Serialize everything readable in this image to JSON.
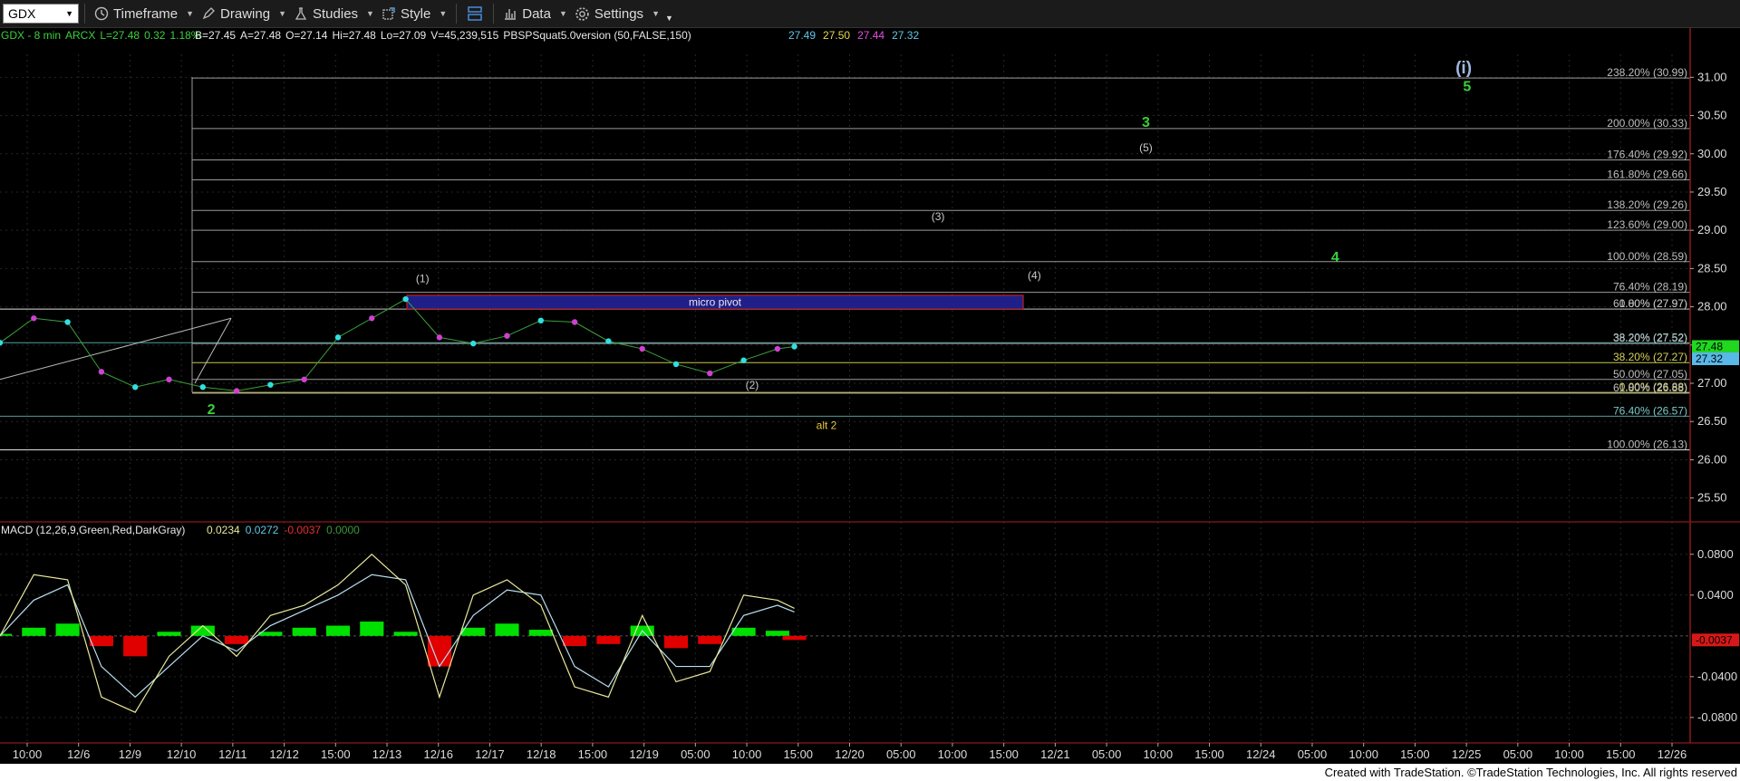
{
  "toolbar": {
    "symbol": "GDX",
    "timeframe_label": "Timeframe",
    "drawing_label": "Drawing",
    "studies_label": "Studies",
    "style_label": "Style",
    "data_label": "Data",
    "settings_label": "Settings"
  },
  "info_bar": {
    "symbol": "GDX - 8 min",
    "exchange": "ARCX",
    "last": "L=27.48",
    "change": "0.32",
    "change_pct": "1.18%",
    "bid": "B=27.45",
    "ask": "A=27.48",
    "open": "O=27.14",
    "high": "Hi=27.48",
    "low": "Lo=27.09",
    "volume": "V=45,239,515",
    "study": "PBSPSquat5.0version (50,FALSE,150)",
    "study_values": [
      "27.49",
      "27.50",
      "27.44",
      "27.32"
    ]
  },
  "colors": {
    "background": "#000000",
    "grid": "#262626",
    "macd_hist_pos": "#00e000",
    "macd_hist_neg": "#e00000",
    "macd_line": "#e8e89a",
    "signal_line": "#b8e0f0",
    "wave_green": "#3ad13a",
    "pivot_box": "#1f1f8a",
    "price_candle": "#30e0e0",
    "price_dot": "#d040d0"
  },
  "chart_data": [
    {
      "type": "line",
      "panel": "price",
      "y_axis": {
        "range": [
          25.2,
          31.3
        ],
        "ticks": [
          "31.00",
          "30.50",
          "30.00",
          "29.50",
          "29.00",
          "28.50",
          "28.00",
          "27.50",
          "27.00",
          "26.50",
          "26.00",
          "25.50"
        ]
      },
      "x_axis": {
        "ticks": [
          "10:00",
          "12/6",
          "12/9",
          "12/10",
          "12/11",
          "12/12",
          "15:00",
          "12/13",
          "12/16",
          "12/17",
          "12/18",
          "15:00",
          "12/19",
          "05:00",
          "10:00",
          "15:00",
          "12/20",
          "05:00",
          "10:00",
          "15:00",
          "12/21",
          "05:00",
          "10:00",
          "15:00",
          "12/24",
          "05:00",
          "10:00",
          "15:00",
          "12/25",
          "05:00",
          "10:00",
          "15:00",
          "12/26"
        ]
      },
      "series": [
        {
          "x": [
            0,
            0.02,
            0.04,
            0.06,
            0.08,
            0.1,
            0.12,
            0.14,
            0.16,
            0.18,
            0.2,
            0.22,
            0.24,
            0.26,
            0.28,
            0.3,
            0.32,
            0.34,
            0.36,
            0.38,
            0.4,
            0.42,
            0.44,
            0.46,
            0.47
          ],
          "values": [
            27.53,
            27.85,
            27.8,
            27.15,
            26.95,
            27.05,
            26.95,
            26.9,
            26.98,
            27.05,
            27.6,
            27.85,
            28.1,
            27.6,
            27.52,
            27.62,
            27.82,
            27.8,
            27.55,
            27.45,
            27.25,
            27.13,
            27.3,
            27.45,
            27.48
          ]
        }
      ],
      "fib_levels": [
        {
          "label": "238.20% (30.99)",
          "value": 30.99,
          "color": "#9a9a9a"
        },
        {
          "label": "200.00% (30.33)",
          "value": 30.33,
          "color": "#9a9a9a"
        },
        {
          "label": "176.40% (29.92)",
          "value": 29.92,
          "color": "#9a9a9a"
        },
        {
          "label": "161.80% (29.66)",
          "value": 29.66,
          "color": "#9a9a9a"
        },
        {
          "label": "138.20% (29.26)",
          "value": 29.26,
          "color": "#9a9a9a"
        },
        {
          "label": "123.60% (29.00)",
          "value": 29.0,
          "color": "#9a9a9a"
        },
        {
          "label": "100.00% (28.59)",
          "value": 28.59,
          "color": "#9a9a9a"
        },
        {
          "label": "76.40% (28.19)",
          "value": 28.19,
          "color": "#9a9a9a"
        },
        {
          "label": "0.00% (27.97)",
          "value": 27.97,
          "color": "#e0e0e0"
        },
        {
          "label": "61.80% (27.97)",
          "value": 27.97,
          "color": "#9a9a9a"
        },
        {
          "label": "38.20% (27.52)",
          "value": 27.53,
          "color": "#4fa0a0"
        },
        {
          "label": "38.20% (27.52)",
          "value": 27.52,
          "color": "#9a9a9a"
        },
        {
          "label": "38.20% (27.27)",
          "value": 27.27,
          "color": "#c8c84c"
        },
        {
          "label": "50.00% (27.05)",
          "value": 27.05,
          "color": "#9a9a9a"
        },
        {
          "label": "0.00% (26.88)",
          "value": 26.88,
          "color": "#c8c84c"
        },
        {
          "label": "61.80% (26.88)",
          "value": 26.87,
          "color": "#9a9a9a"
        },
        {
          "label": "76.40% (26.57)",
          "value": 26.57,
          "color": "#4fa0a0"
        },
        {
          "label": "100.00% (26.13)",
          "value": 26.13,
          "color": "#e0e0e0"
        }
      ],
      "pivot_box": {
        "label": "micro pivot",
        "from": 27.97,
        "to": 28.15
      },
      "wave_labels": [
        {
          "text": "(1)",
          "x": 0.25,
          "value": 28.32,
          "color": "#cccccc"
        },
        {
          "text": "(2)",
          "x": 0.445,
          "value": 26.93,
          "color": "#cccccc"
        },
        {
          "text": "(3)",
          "x": 0.555,
          "value": 29.13,
          "color": "#cccccc"
        },
        {
          "text": "(4)",
          "x": 0.612,
          "value": 28.36,
          "color": "#cccccc"
        },
        {
          "text": "(5)",
          "x": 0.678,
          "value": 30.03,
          "color": "#cccccc"
        },
        {
          "text": "2",
          "x": 0.125,
          "value": 26.6,
          "color": "#3ad13a"
        },
        {
          "text": "3",
          "x": 0.678,
          "value": 30.35,
          "color": "#3ad13a"
        },
        {
          "text": "4",
          "x": 0.79,
          "value": 28.59,
          "color": "#3ad13a"
        },
        {
          "text": "5",
          "x": 0.868,
          "value": 30.82,
          "color": "#3ad13a"
        },
        {
          "text": "(i)",
          "x": 0.866,
          "value": 31.05,
          "color": "#a0b8e0"
        },
        {
          "text": "alt 2",
          "x": 0.489,
          "value": 26.4,
          "color": "#e8c840"
        }
      ],
      "price_markers": [
        {
          "label": "27.48",
          "value": 27.48,
          "color": "#1fd81f"
        },
        {
          "label": "27.32",
          "value": 27.32,
          "color": "#58b8e8"
        }
      ]
    },
    {
      "type": "bar",
      "panel": "macd",
      "title": "MACD (12,26,9,Green,Red,DarkGray)",
      "values_text": [
        "0.0234",
        "0.0272",
        "-0.0037",
        "0.0000"
      ],
      "y_axis": {
        "range": [
          -0.105,
          0.11
        ],
        "ticks": [
          "0.0800",
          "0.0400",
          "-0.0400",
          "-0.0800"
        ]
      },
      "x": [
        0,
        0.02,
        0.04,
        0.06,
        0.08,
        0.1,
        0.12,
        0.14,
        0.16,
        0.18,
        0.2,
        0.22,
        0.24,
        0.26,
        0.28,
        0.3,
        0.32,
        0.34,
        0.36,
        0.38,
        0.4,
        0.42,
        0.44,
        0.46,
        0.47
      ],
      "histogram": [
        0.002,
        0.008,
        0.012,
        -0.01,
        -0.02,
        0.004,
        0.01,
        -0.008,
        0.004,
        0.008,
        0.01,
        0.014,
        0.004,
        -0.03,
        0.008,
        0.012,
        0.006,
        -0.01,
        -0.008,
        0.01,
        -0.012,
        -0.008,
        0.008,
        0.005,
        -0.004
      ],
      "macd_line": [
        0.0,
        0.06,
        0.055,
        -0.06,
        -0.075,
        -0.02,
        0.01,
        -0.02,
        0.02,
        0.03,
        0.05,
        0.08,
        0.05,
        -0.06,
        0.04,
        0.055,
        0.03,
        -0.05,
        -0.06,
        0.02,
        -0.045,
        -0.035,
        0.04,
        0.035,
        0.027
      ],
      "signal_line": [
        0.0,
        0.035,
        0.05,
        -0.03,
        -0.06,
        -0.03,
        0.0,
        -0.015,
        0.01,
        0.025,
        0.04,
        0.06,
        0.055,
        -0.03,
        0.02,
        0.045,
        0.04,
        -0.03,
        -0.05,
        0.005,
        -0.03,
        -0.03,
        0.02,
        0.03,
        0.0234
      ],
      "last_value_label": "-0.0037"
    }
  ],
  "footer": {
    "text": "Created with TradeStation. ©TradeStation Technologies, Inc. All rights reserved"
  }
}
